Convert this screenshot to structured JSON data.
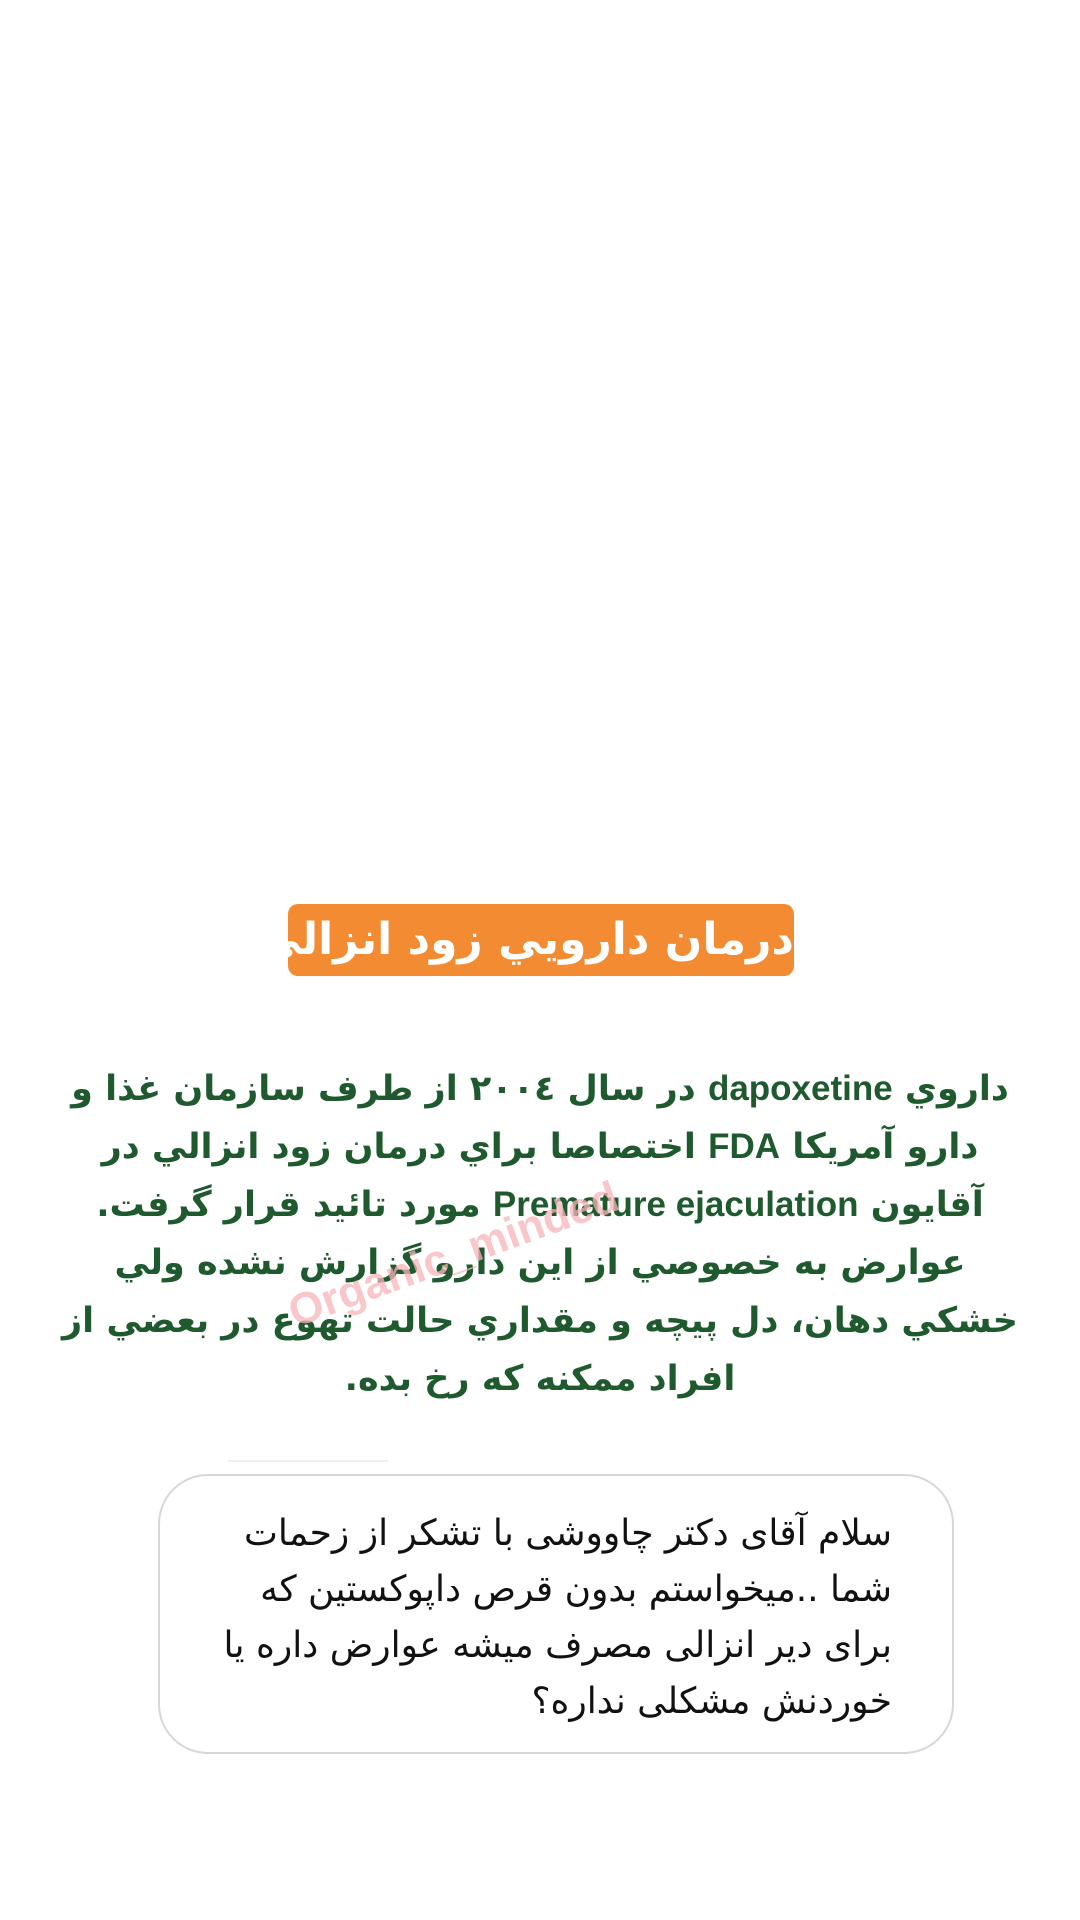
{
  "story": {
    "title": "درمان دارويي زود انزالي",
    "watermark": "Organic_minded",
    "body": {
      "p1_a": "داروي",
      "drug_name": "dapoxetine",
      "p1_b": "در سال ٢٠٠٤ از طرف سازمان غذا و دارو آمريكا",
      "agency": "FDA",
      "p1_c": "اختصاصا براي درمان زود انزالي در آقايون",
      "condition_en": "Premature ejaculation",
      "p1_d": "مورد تائيد قرار گرفت.",
      "p2": "عوارض به خصوصي از اين دارو گزارش نشده ولي خشكي دهان، دل پيچه و مقداري حالت تهوع در بعضي از افراد ممكنه كه رخ بده."
    },
    "question": {
      "line1": "سلام آقای دکتر چاووشی با تشکر از زحمات",
      "line2": "شما ..میخواستم بدون قرص داپوکستین  که",
      "line3": "برای دیر انزالی مصرف میشه عوارض داره یا",
      "line4": "خوردنش مشکلی نداره؟"
    }
  }
}
